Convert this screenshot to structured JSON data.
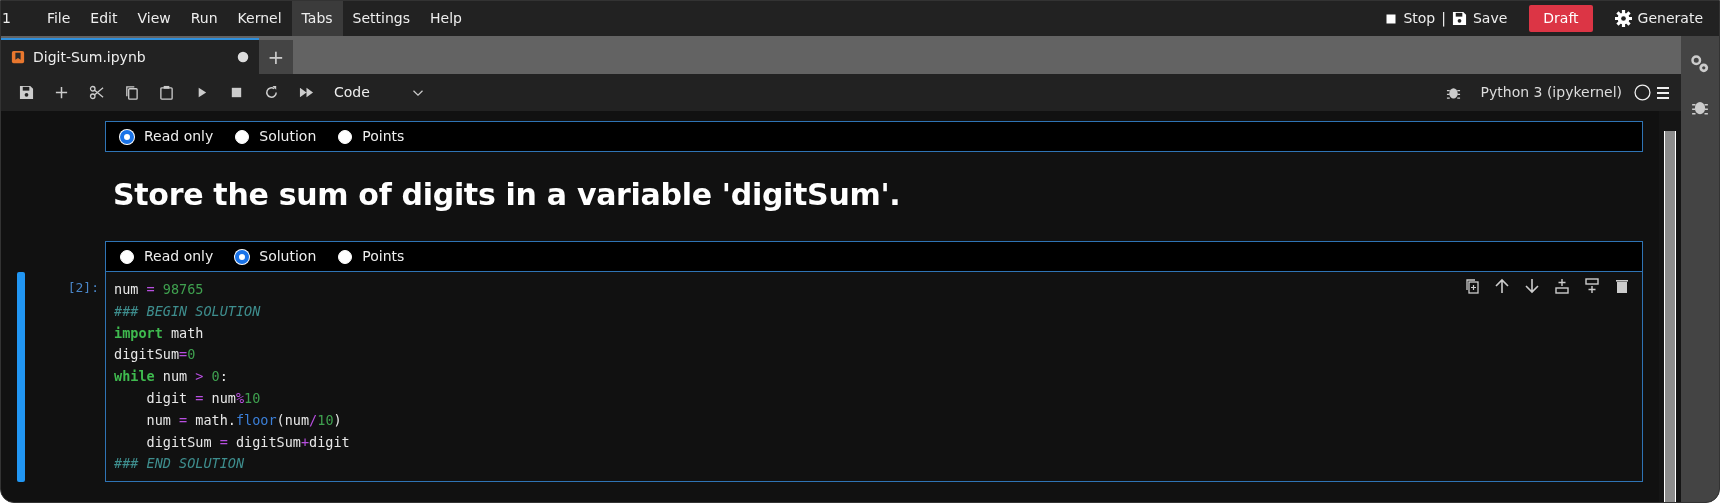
{
  "edge_text": "1",
  "menu": [
    {
      "label": "File",
      "selected": false
    },
    {
      "label": "Edit",
      "selected": false
    },
    {
      "label": "View",
      "selected": false
    },
    {
      "label": "Run",
      "selected": false
    },
    {
      "label": "Kernel",
      "selected": false
    },
    {
      "label": "Tabs",
      "selected": true
    },
    {
      "label": "Settings",
      "selected": false
    },
    {
      "label": "Help",
      "selected": false
    }
  ],
  "top_actions": {
    "stop": "Stop",
    "separator": "|",
    "save": "Save",
    "draft": "Draft",
    "generate": "Generate"
  },
  "tabs": [
    {
      "label": "Digit-Sum.ipynb",
      "selected": true,
      "unsaved": true
    }
  ],
  "new_tab": "+",
  "toolbar": {
    "cell_type": "Code",
    "kernel": "Python 3 (ipykernel)"
  },
  "cells": [
    {
      "kind": "markdown",
      "options": [
        {
          "label": "Read only",
          "selected": true
        },
        {
          "label": "Solution",
          "selected": false
        },
        {
          "label": "Points",
          "selected": false
        }
      ],
      "heading": "Store the sum of digits in a variable 'digitSum'."
    },
    {
      "kind": "code",
      "active": true,
      "prompt": "[2]:",
      "options": [
        {
          "label": "Read only",
          "selected": false
        },
        {
          "label": "Solution",
          "selected": true
        },
        {
          "label": "Points",
          "selected": false
        }
      ],
      "lines": [
        [
          {
            "text": "num ",
            "kind": "name"
          },
          {
            "text": "=",
            "kind": "operator"
          },
          {
            "text": " 98765",
            "kind": "number"
          }
        ],
        [
          {
            "text": "### BEGIN SOLUTION",
            "kind": "comment"
          }
        ],
        [
          {
            "text": "import",
            "kind": "keyword"
          },
          {
            "text": " math",
            "kind": "name"
          }
        ],
        [
          {
            "text": "digitSum",
            "kind": "name"
          },
          {
            "text": "=",
            "kind": "operator"
          },
          {
            "text": "0",
            "kind": "number"
          }
        ],
        [
          {
            "text": "while",
            "kind": "keyword"
          },
          {
            "text": " num ",
            "kind": "name"
          },
          {
            "text": ">",
            "kind": "operator"
          },
          {
            "text": " 0",
            "kind": "number"
          },
          {
            "text": ":",
            "kind": "name"
          }
        ],
        [
          {
            "text": "    digit ",
            "kind": "name"
          },
          {
            "text": "=",
            "kind": "operator"
          },
          {
            "text": " num",
            "kind": "name"
          },
          {
            "text": "%",
            "kind": "operator"
          },
          {
            "text": "10",
            "kind": "number"
          }
        ],
        [
          {
            "text": "    num ",
            "kind": "name"
          },
          {
            "text": "=",
            "kind": "operator"
          },
          {
            "text": " math.",
            "kind": "name"
          },
          {
            "text": "floor",
            "kind": "property"
          },
          {
            "text": "(num",
            "kind": "name"
          },
          {
            "text": "/",
            "kind": "operator"
          },
          {
            "text": "10",
            "kind": "number"
          },
          {
            "text": ")",
            "kind": "name"
          }
        ],
        [
          {
            "text": "    digitSum ",
            "kind": "name"
          },
          {
            "text": "=",
            "kind": "operator"
          },
          {
            "text": " digitSum",
            "kind": "name"
          },
          {
            "text": "+",
            "kind": "operator"
          },
          {
            "text": "digit",
            "kind": "name"
          }
        ],
        [
          {
            "text": "### END SOLUTION",
            "kind": "comment"
          }
        ]
      ]
    }
  ]
}
